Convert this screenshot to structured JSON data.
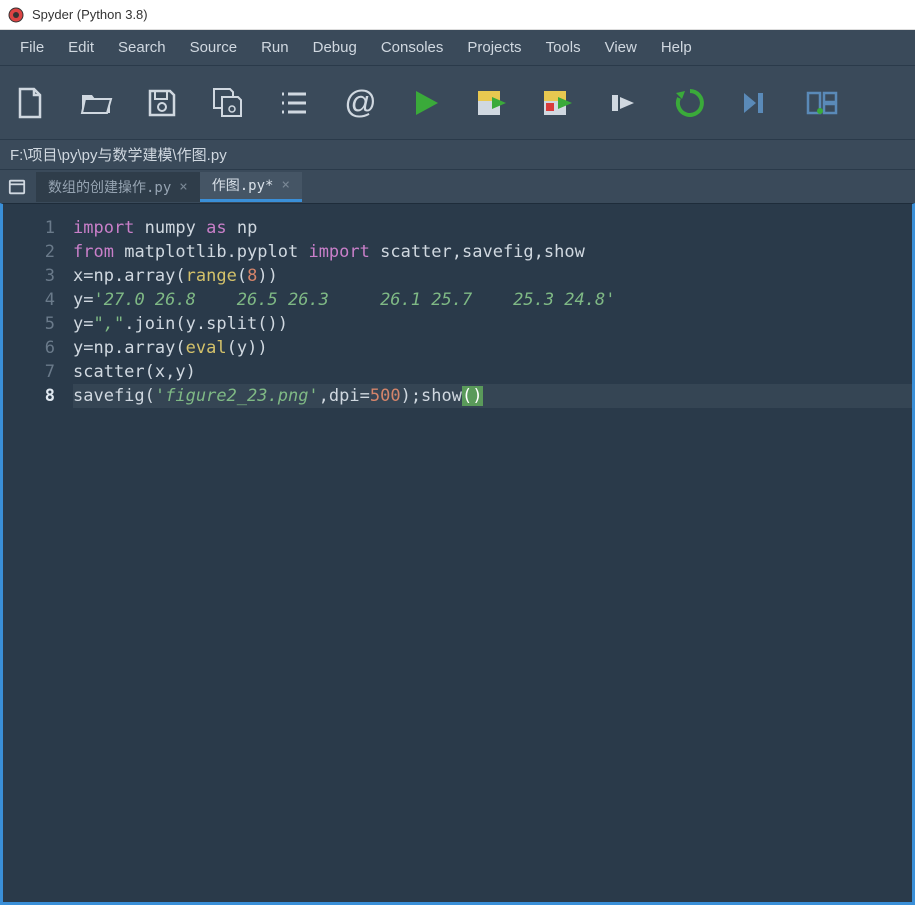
{
  "window": {
    "title": "Spyder (Python 3.8)"
  },
  "menu": {
    "file": "File",
    "edit": "Edit",
    "search": "Search",
    "source": "Source",
    "run": "Run",
    "debug": "Debug",
    "consoles": "Consoles",
    "projects": "Projects",
    "tools": "Tools",
    "view": "View",
    "help": "Help"
  },
  "filepath": "F:\\项目\\py\\py与数学建模\\作图.py",
  "tabs": {
    "inactive": {
      "label": "数组的创建操作.py",
      "close": "×"
    },
    "active": {
      "label": "作图.py*",
      "close": "×"
    }
  },
  "gutter": [
    "1",
    "2",
    "3",
    "4",
    "5",
    "6",
    "7",
    "8"
  ],
  "code": {
    "l1": {
      "kw1": "import",
      "sp1": " ",
      "mod": "numpy",
      "sp2": " ",
      "kw2": "as",
      "sp3": " ",
      "alias": "np"
    },
    "l2": {
      "kw1": "from",
      "sp1": " ",
      "mod": "matplotlib.pyplot",
      "sp2": " ",
      "kw2": "import",
      "sp3": " ",
      "names": "scatter,savefig,show"
    },
    "l3": {
      "a": "x",
      "eq": "=",
      "np": "np.",
      "arr": "array",
      "op": "(",
      "rng": "range",
      "op2": "(",
      "n": "8",
      "cl": "))"
    },
    "l4": {
      "a": "y",
      "eq": "=",
      "str": "'27.0 26.8    26.5 26.3     26.1 25.7    25.3 24.8'"
    },
    "l5": {
      "a": "y",
      "eq": "=",
      "str": "\",\"",
      "j": ".join(y.split())"
    },
    "l6": {
      "a": "y",
      "eq": "=",
      "np": "np.",
      "arr": "array",
      "op": "(",
      "ev": "eval",
      "op2": "(y))"
    },
    "l7": {
      "fn": "scatter",
      "args": "(x,y)"
    },
    "l8": {
      "fn": "savefig",
      "op": "(",
      "str": "'figure2_23.png'",
      "c": ",dpi=",
      "n": "500",
      "mid": ");show",
      "p1": "(",
      "p2": ")"
    }
  },
  "icons": {
    "new": "new-file",
    "open": "open-folder",
    "save": "save",
    "saveall": "save-all",
    "list": "list",
    "at": "@",
    "run": "run",
    "runcell": "run-cell",
    "runcell2": "run-cell-next",
    "debug": "debug-step",
    "reload": "reload",
    "end": "goto-end",
    "layout": "layout"
  }
}
